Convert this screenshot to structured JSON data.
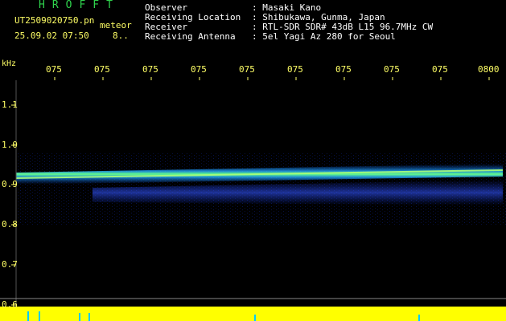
{
  "header": {
    "logo": "HROFFT",
    "filename": "UT2509020750.pn",
    "filename_suffix": "meteor",
    "datetime": "25.09.02 07:50",
    "frame_label": "8..",
    "fields": [
      {
        "label": "Observer",
        "value": ": Masaki Kano"
      },
      {
        "label": "Receiving Location",
        "value": ": Shibukawa, Gunma, Japan"
      },
      {
        "label": "Receiver",
        "value": ": RTL-SDR SDR# 43dB L15 96.7MHz CW"
      },
      {
        "label": "Receiving Antenna",
        "value": ": 5el Yagi Az 280 for Seoul"
      }
    ]
  },
  "axis": {
    "y_unit": "kHz",
    "x_ticks": [
      "075",
      "075",
      "075",
      "075",
      "075",
      "075",
      "075",
      "075",
      "075",
      "0800"
    ],
    "y_ticks": [
      "1.1",
      "1.0",
      "0.9",
      "0.8",
      "0.7",
      "0.6"
    ]
  },
  "colors": {
    "background": "#000000",
    "label": "#ffff66",
    "logo": "#2fd34d",
    "signal_main": "#33ff99",
    "signal_echo": "#3355ff",
    "baseline": "#ffff00"
  }
}
